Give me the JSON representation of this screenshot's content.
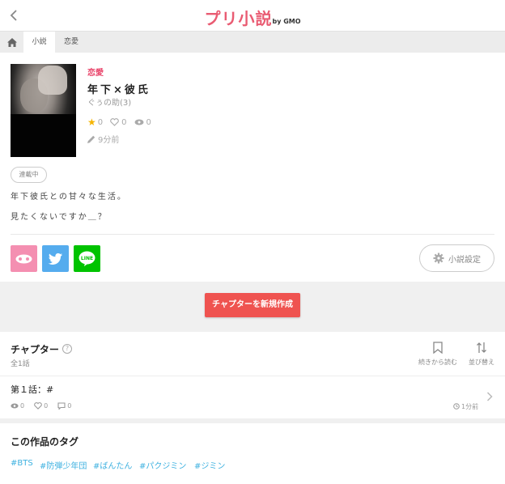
{
  "header": {
    "logo_main": "プリ小説",
    "logo_sub": "by GMO"
  },
  "breadcrumb": {
    "items": [
      "小説",
      "恋愛"
    ]
  },
  "novel": {
    "genre": "恋愛",
    "title": "年下×彼氏",
    "author": "ぐぅの助(3)",
    "stars": "0",
    "likes": "0",
    "views": "0",
    "updated": "9分前",
    "status": "連載中",
    "description": [
      "年下彼氏との甘々な生活。",
      "見たくないですか＿？"
    ],
    "settings_label": "小説設定"
  },
  "actions": {
    "new_chapter": "チャプターを新規作成"
  },
  "chapters": {
    "heading": "チャプター",
    "help": "?",
    "count": "全1話",
    "continue_label": "続きから読む",
    "sort_label": "並び替え",
    "items": [
      {
        "title": "第１話：#",
        "views": "0",
        "likes": "0",
        "comments": "0",
        "time": "1分前"
      }
    ]
  },
  "tags": {
    "heading": "この作品のタグ",
    "items": [
      "#BTS",
      "#防弾少年団",
      "#ばんたん",
      "#パクジミン",
      "#ジミン"
    ]
  },
  "colors": {
    "accent": "#e9446a",
    "button_red": "#ef5350",
    "tag_blue": "#3eb1e0",
    "twitter": "#55acee",
    "line": "#00c300",
    "prichan": "#f48fb1",
    "star": "#f5b400"
  }
}
